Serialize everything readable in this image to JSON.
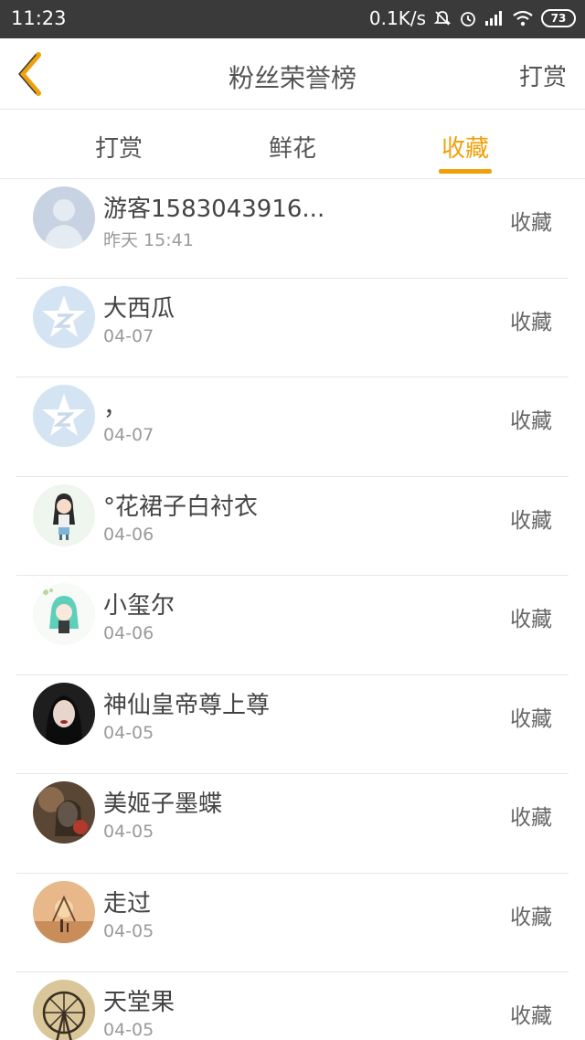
{
  "status_bar": {
    "time": "11:23",
    "network_speed": "0.1K/s",
    "battery": "73"
  },
  "header": {
    "title": "粉丝荣誉榜",
    "action_label": "打赏",
    "back_icon": "chevron-left-icon",
    "accent_color": "#f0a00a"
  },
  "tabs": [
    {
      "label": "打赏",
      "active": false
    },
    {
      "label": "鲜花",
      "active": false
    },
    {
      "label": "收藏",
      "active": true
    }
  ],
  "fans": [
    {
      "name": "游客1583043916...",
      "date": "昨天 15:41",
      "action": "收藏",
      "avatar": "default-user-avatar"
    },
    {
      "name": "大西瓜",
      "date": "04-07",
      "action": "收藏",
      "avatar": "qq-star-avatar"
    },
    {
      "name": "，",
      "date": "04-07",
      "action": "收藏",
      "avatar": "qq-star-avatar"
    },
    {
      "name": "°花裙子白衬衣",
      "date": "04-06",
      "action": "收藏",
      "avatar": "girl-cartoon-avatar"
    },
    {
      "name": "小玺尔",
      "date": "04-06",
      "action": "收藏",
      "avatar": "anime-character-avatar"
    },
    {
      "name": "神仙皇帝尊上尊",
      "date": "04-05",
      "action": "收藏",
      "avatar": "portrait-photo-avatar"
    },
    {
      "name": "美姬子墨蝶",
      "date": "04-05",
      "action": "收藏",
      "avatar": "art-photo-avatar"
    },
    {
      "name": "走过",
      "date": "04-05",
      "action": "收藏",
      "avatar": "sunset-photo-avatar"
    },
    {
      "name": "天堂果",
      "date": "04-05",
      "action": "收藏",
      "avatar": "ferris-wheel-avatar"
    }
  ]
}
